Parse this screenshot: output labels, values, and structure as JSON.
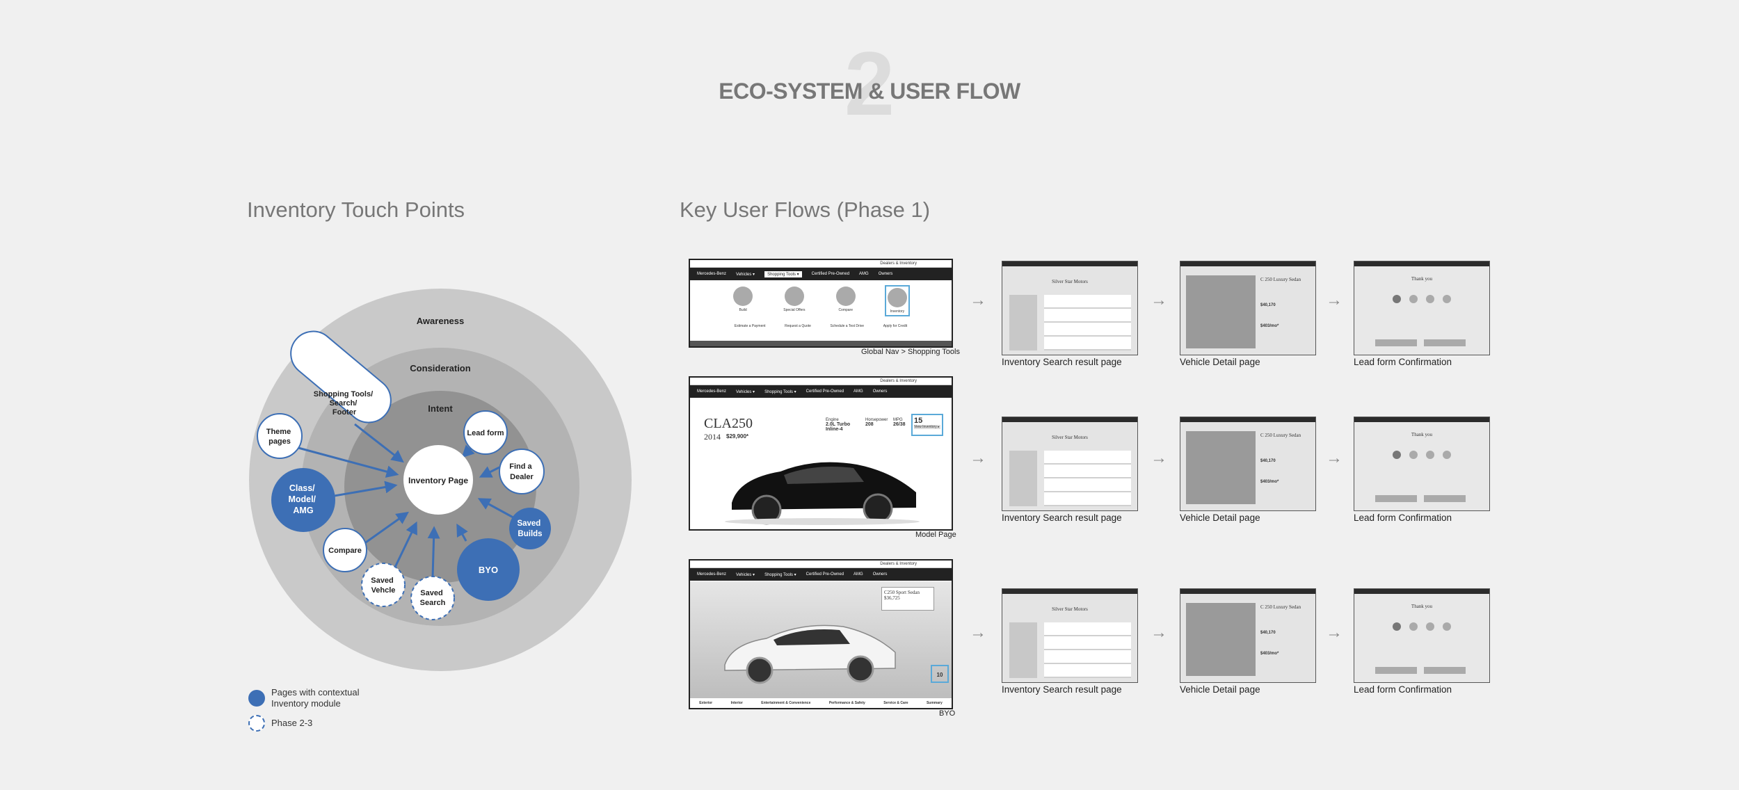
{
  "header": {
    "number": "2",
    "title": "ECO-SYSTEM & USER FLOW"
  },
  "touchpoints": {
    "title": "Inventory Touch Points",
    "rings": {
      "awareness": "Awareness",
      "consideration": "Consideration",
      "intent": "Intent"
    },
    "center": "Inventory Page",
    "nodes": {
      "shopping_tools": [
        "Shopping Tools/",
        "Search/",
        "Footer"
      ],
      "theme_pages": [
        "Theme",
        "pages"
      ],
      "class_model": [
        "Class/",
        "Model/",
        "AMG"
      ],
      "compare": "Compare",
      "saved_vehicle": [
        "Saved",
        "Vehcle"
      ],
      "saved_search": [
        "Saved",
        "Search"
      ],
      "byo": "BYO",
      "saved_builds": [
        "Saved",
        "Builds"
      ],
      "find_dealer": [
        "Find a",
        "Dealer"
      ],
      "lead_form": "Lead form"
    },
    "legend": {
      "contextual": [
        "Pages with contextual",
        "Inventory module"
      ],
      "phase": "Phase 2-3"
    },
    "colors": {
      "outer": "#c9c9c9",
      "middle": "#b3b3b3",
      "inner": "#929292",
      "blue": "#3d6fb5"
    }
  },
  "flows": {
    "title": "Key User Flows (Phase 1)",
    "rows": [
      {
        "caption": "Global Nav > Shopping Tools",
        "topbar": "Dealers & Inventory",
        "brand": "Mercedes-Benz",
        "nav": [
          "Vehicles ▾",
          "Shopping Tools ▾",
          "Certified Pre-Owned",
          "AMG",
          "Owners"
        ],
        "tools": [
          "Build",
          "Special Offers",
          "Compare",
          "Inventory"
        ],
        "tool_links": [
          "Estimate a Payment",
          "Request a Quote",
          "Schedule a Test Drive",
          "Apply for Credit"
        ],
        "steps": [
          "Inventory Search result page",
          "Vehicle Detail page",
          "Lead form Confirmation"
        ]
      },
      {
        "caption": "Model Page",
        "topbar": "Dealers & Inventory",
        "brand": "Mercedes-Benz",
        "nav": [
          "Vehicles ▾",
          "Shopping Tools ▾",
          "Certified Pre-Owned",
          "AMG",
          "Owners"
        ],
        "model": "CLA250",
        "year": "2014",
        "price": "$29,900*",
        "specs": [
          {
            "label": "Engine",
            "value": "2.0L Turbo Inline-4"
          },
          {
            "label": "Horsepower",
            "value": "208"
          },
          {
            "label": "MPG",
            "value": "26/38"
          }
        ],
        "inventory_count": "15",
        "inventory_cta": "View Inventory ▸",
        "steps": [
          "Inventory Search result page",
          "Vehicle Detail page",
          "Lead form Confirmation"
        ]
      },
      {
        "caption": "BYO",
        "topbar": "Dealers & Inventory",
        "brand": "Mercedes-Benz",
        "nav": [
          "Vehicles ▾",
          "Shopping Tools ▾",
          "Certified Pre-Owned",
          "AMG",
          "Owners"
        ],
        "summary_title": "C250 Sport Sedan",
        "summary_price": "$36,725",
        "available": "10",
        "tabs": [
          "Exterior",
          "Interior",
          "Entertainment & Convenience",
          "Performance & Safety",
          "Service & Care",
          "Summary"
        ],
        "steps": [
          "Inventory Search result page",
          "Vehicle Detail page",
          "Lead form Confirmation"
        ]
      }
    ],
    "thumbs": {
      "search_title": "Silver Star Motors",
      "detail_title": "C 250 Luxury Sedan",
      "detail_price": "$40,170",
      "detail_msrp": "$403/mo*",
      "lead_title": "Thank you"
    }
  }
}
